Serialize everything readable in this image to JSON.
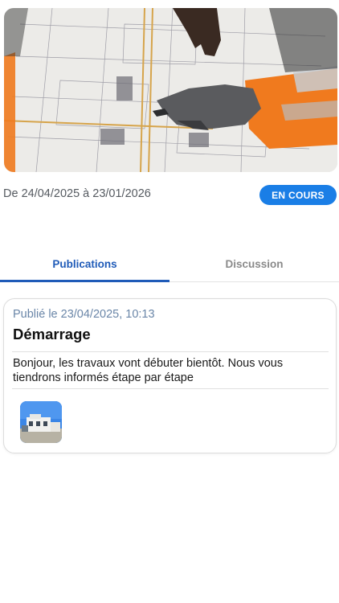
{
  "project": {
    "date_range": "De 24/04/2025 à 23/01/2026",
    "status_badge": "EN COURS"
  },
  "tabs": [
    {
      "label": "Publications",
      "active": true
    },
    {
      "label": "Discussion",
      "active": false
    }
  ],
  "publications": [
    {
      "published_at": "Publié le 23/04/2025, 10:13",
      "title": "Démarrage",
      "body": "Bonjour, les travaux vont débuter bientôt. Nous vous tiendrons informés étape par étape",
      "attachments": 1
    }
  ],
  "colors": {
    "accent": "#1f5bb8",
    "badge": "#1a7ee6",
    "muted": "#8a8a8a"
  }
}
